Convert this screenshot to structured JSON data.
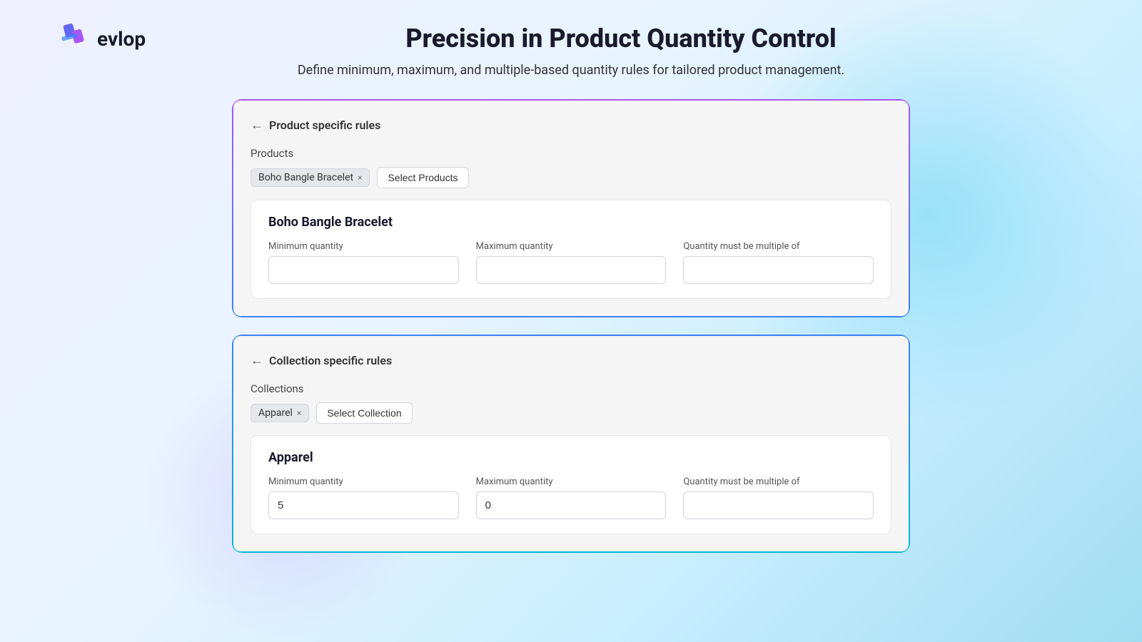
{
  "logo": {
    "text": "evlop"
  },
  "header": {
    "title": "Precision in Product Quantity Control",
    "subtitle": "Define minimum, maximum, and multiple-based quantity rules for tailored product management."
  },
  "product_card": {
    "back_label": "Product specific rules",
    "section_label": "Products",
    "tag_text": "Boho Bangle Bracelet",
    "select_button": "Select Products",
    "detail_title": "Boho Bangle Bracelet",
    "min_qty_label": "Minimum quantity",
    "max_qty_label": "Maximum quantity",
    "multiple_label": "Quantity must be multiple of",
    "min_qty_value": "",
    "max_qty_value": "",
    "multiple_value": ""
  },
  "collection_card": {
    "back_label": "Collection specific rules",
    "section_label": "Collections",
    "tag_text": "Apparel",
    "select_button": "Select Collection",
    "detail_title": "Apparel",
    "min_qty_label": "Minimum quantity",
    "max_qty_label": "Maximum quantity",
    "multiple_label": "Quantity must be multiple of",
    "min_qty_value": "5",
    "max_qty_value": "0",
    "multiple_value": ""
  }
}
